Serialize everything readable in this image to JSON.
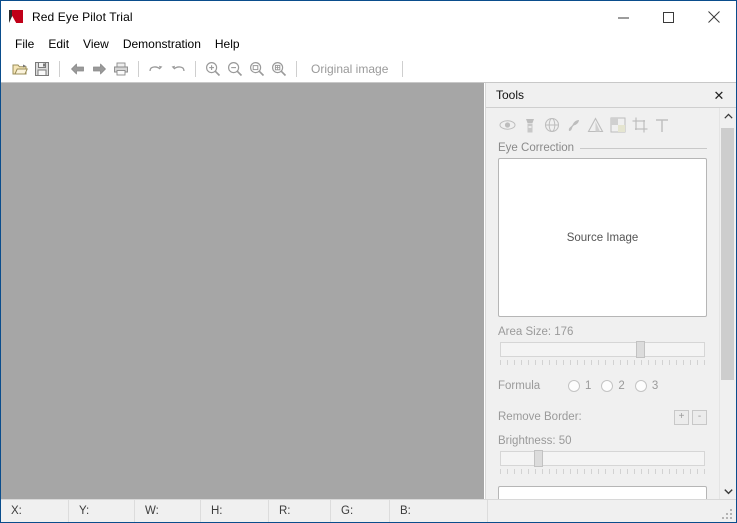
{
  "window": {
    "title": "Red Eye Pilot Trial",
    "icon": "app-logo-icon",
    "controls": {
      "minimize": "minimize-icon",
      "maximize": "maximize-icon",
      "close": "close-icon"
    }
  },
  "menubar": {
    "items": [
      {
        "label": "File"
      },
      {
        "label": "Edit"
      },
      {
        "label": "View"
      },
      {
        "label": "Demonstration"
      },
      {
        "label": "Help"
      }
    ]
  },
  "toolbar": {
    "buttons": [
      {
        "name": "open-icon"
      },
      {
        "name": "save-icon"
      },
      {
        "name": "back-arrow-icon"
      },
      {
        "name": "forward-arrow-icon"
      },
      {
        "name": "print-icon"
      },
      {
        "name": "undo-icon"
      },
      {
        "name": "redo-icon"
      },
      {
        "name": "zoom-in-icon"
      },
      {
        "name": "zoom-out-icon"
      },
      {
        "name": "zoom-fit-icon"
      },
      {
        "name": "zoom-actual-icon"
      }
    ],
    "original_image_label": "Original image"
  },
  "canvas": {
    "background_color": "#a6a6a6"
  },
  "tools": {
    "title": "Tools",
    "close_label": "✕",
    "tool_icons": [
      {
        "name": "eye-icon"
      },
      {
        "name": "flashlight-icon"
      },
      {
        "name": "globe-icon"
      },
      {
        "name": "brush-icon"
      },
      {
        "name": "cone-icon"
      },
      {
        "name": "gradient-icon"
      },
      {
        "name": "crop-icon"
      },
      {
        "name": "text-icon"
      }
    ],
    "section_title": "Eye Correction",
    "preview_label": "Source Image",
    "area_size": {
      "label": "Area Size: 176",
      "value": 176,
      "percent": 67
    },
    "formula": {
      "label": "Formula",
      "options": [
        "1",
        "2",
        "3"
      ],
      "selected": null
    },
    "remove_border": {
      "label": "Remove Border:",
      "plus": "+",
      "minus": "-"
    },
    "brightness": {
      "label": "Brightness: 50",
      "value": 50,
      "percent": 17
    }
  },
  "statusbar": {
    "fields": [
      {
        "label": "X:",
        "value": ""
      },
      {
        "label": "Y:",
        "value": ""
      },
      {
        "label": "W:",
        "value": ""
      },
      {
        "label": "H:",
        "value": ""
      },
      {
        "label": "R:",
        "value": ""
      },
      {
        "label": "G:",
        "value": ""
      },
      {
        "label": "B:",
        "value": ""
      },
      {
        "label": "",
        "value": ""
      }
    ]
  }
}
